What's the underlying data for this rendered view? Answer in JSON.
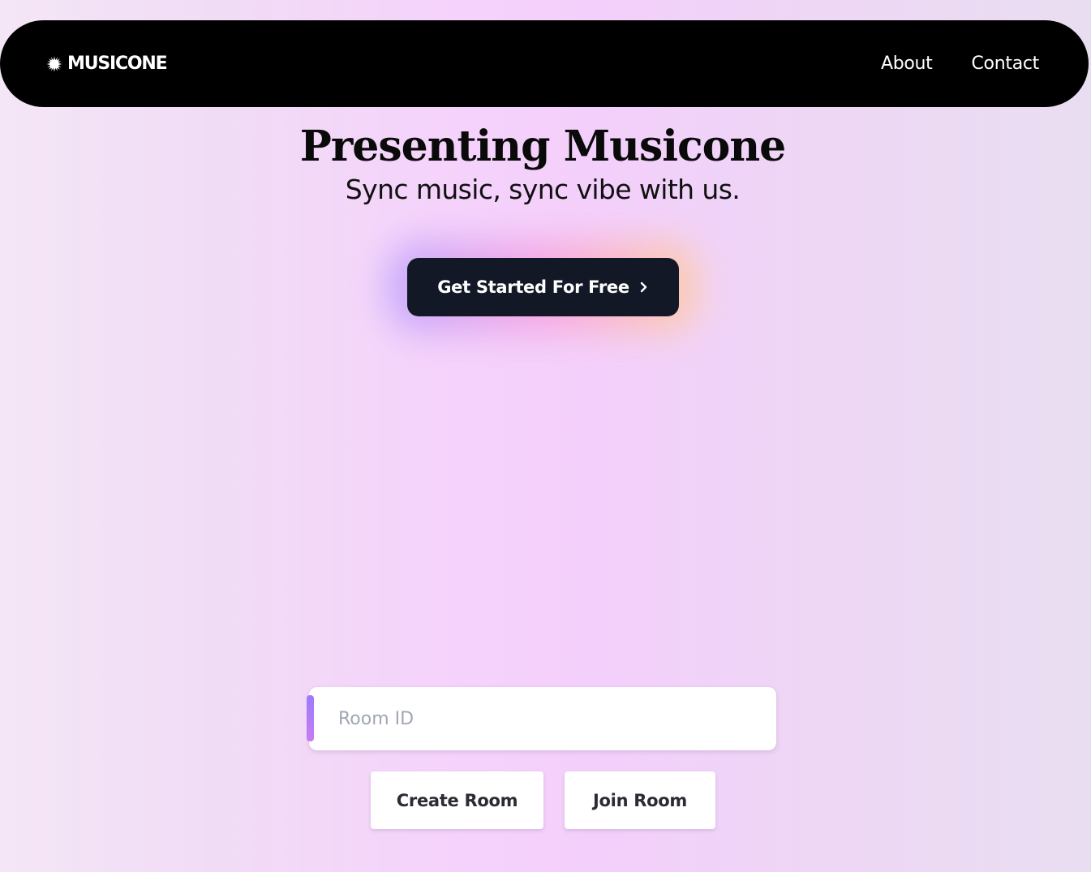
{
  "navbar": {
    "brand": "MUSICONE",
    "brand_icon": "sparkle-logo-icon",
    "links": [
      {
        "label": "About"
      },
      {
        "label": "Contact"
      }
    ]
  },
  "hero": {
    "title": "Presenting Musicone",
    "subtitle": "Sync music, sync vibe with us."
  },
  "cta": {
    "label": "Get Started For Free",
    "icon": "chevron-right-icon"
  },
  "room": {
    "placeholder": "Room ID",
    "value": "",
    "create_label": "Create Room",
    "join_label": "Join Room"
  },
  "colors": {
    "navbar_bg": "#000000",
    "cta_bg": "#121826",
    "accent": "#9b7bff",
    "background": "#f3cffb"
  }
}
